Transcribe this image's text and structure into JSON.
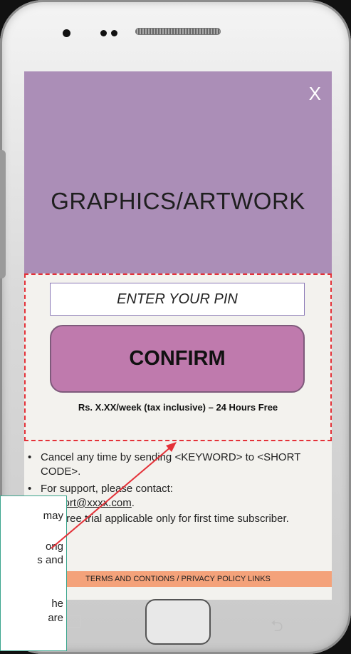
{
  "hero": {
    "title": "GRAPHICS/ARTWORK",
    "close_label": "X",
    "background_color": "#ab8eb7"
  },
  "pin": {
    "placeholder": "ENTER YOUR PIN"
  },
  "confirm_label": "CONFIRM",
  "price_text": "Rs. X.XX/week (tax inclusive) – 24 Hours Free",
  "terms": {
    "bullet_symbol": "•",
    "cancel_text": "Cancel any time by sending <KEYWORD> to <SHORT CODE>.",
    "support_prefix": "For support, please contact:",
    "support_email": "support@xxxx.com",
    "support_suffix": ".",
    "free_trial_text": "Free trial applicable only for first time subscriber."
  },
  "policy_links": "TERMS AND CONTIONS / PRIVACY POLICY LINKS",
  "callout_fragments": [
    "may",
    "ong",
    "s and",
    "he",
    "are"
  ],
  "colors": {
    "confirm_fill": "#bf7aad",
    "dashed_border": "#e43138",
    "policy_bar": "#f4a27a",
    "callout_border": "#3aa58d"
  }
}
